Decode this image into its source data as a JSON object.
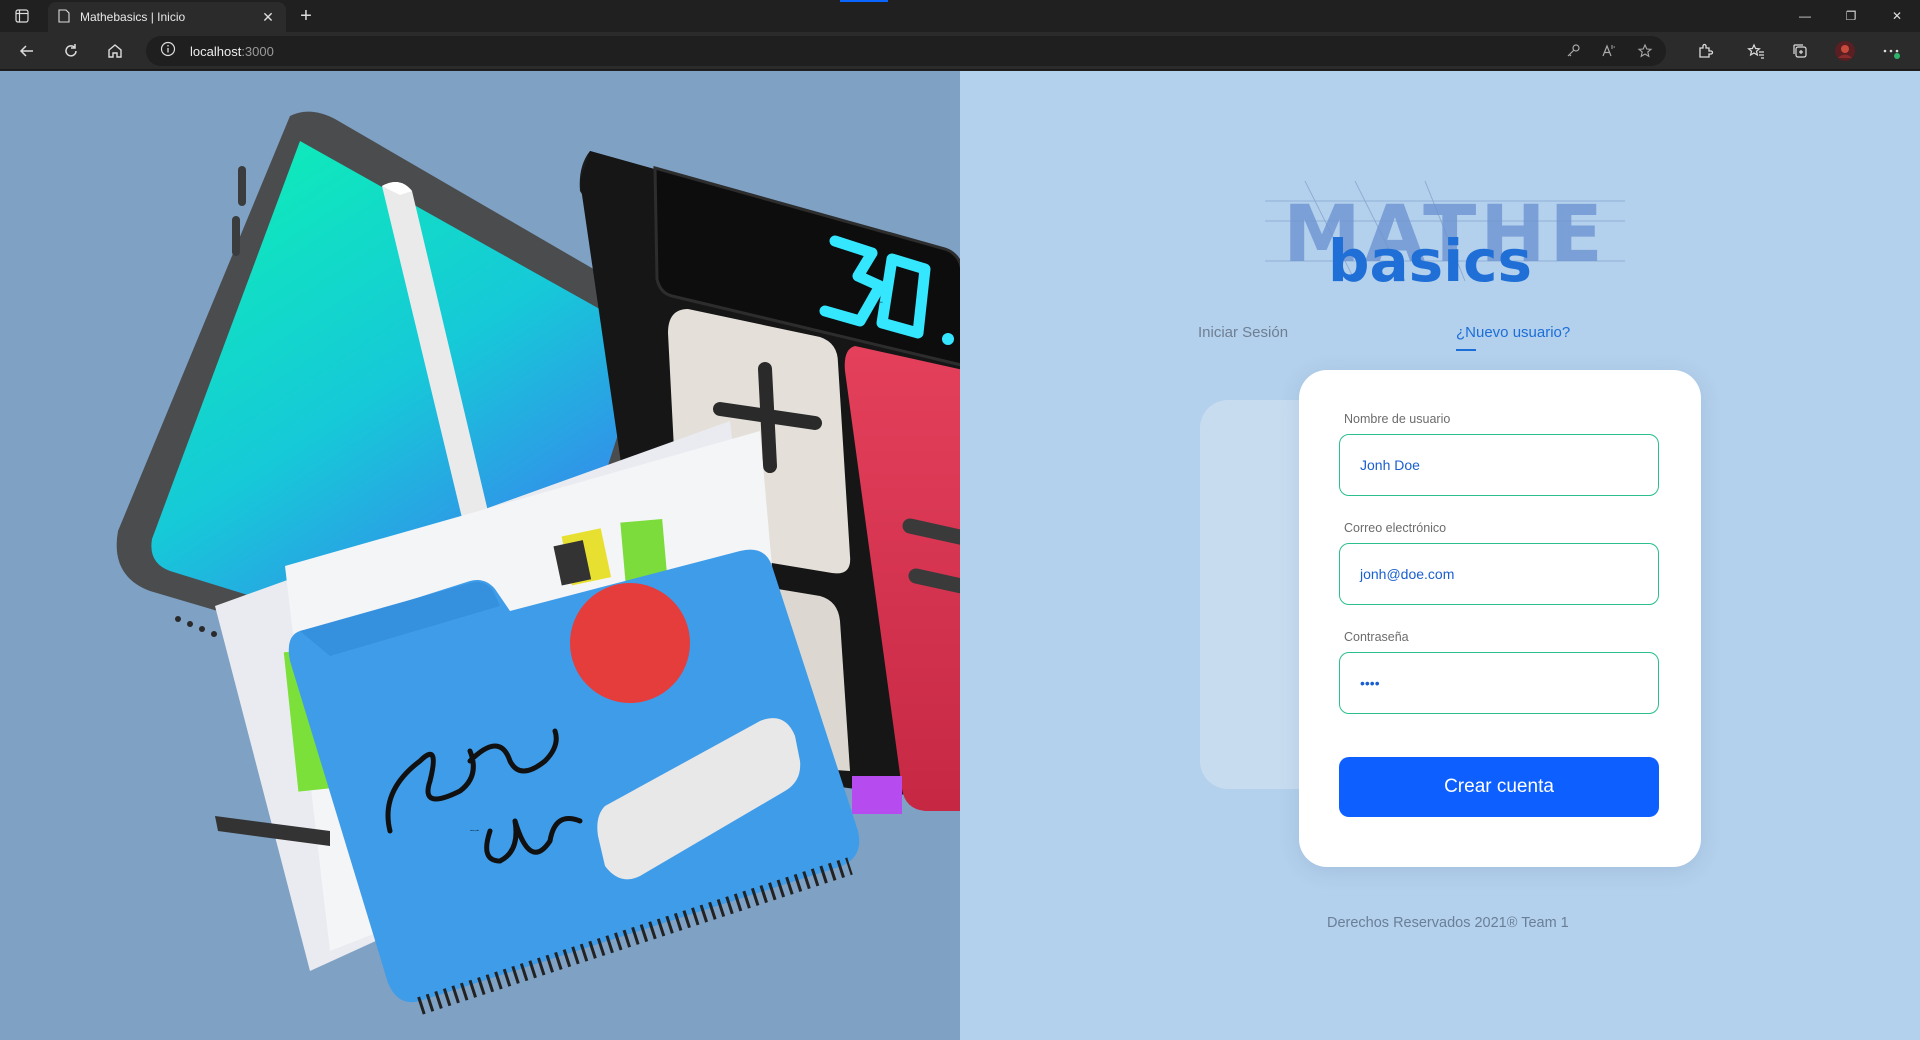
{
  "browser": {
    "tab_title": "Mathebasics | Inicio",
    "url_host": "localhost",
    "url_port": ":3000"
  },
  "logo": {
    "top_text": "MATHE",
    "bottom_text": "basics"
  },
  "auth_tabs": {
    "login": "Iniciar Sesión",
    "register": "¿Nuevo usuario?"
  },
  "form": {
    "username_label": "Nombre de usuario",
    "username_value": "Jonh Doe",
    "email_label": "Correo electrónico",
    "email_value": "jonh@doe.com",
    "password_label": "Contraseña",
    "password_value": "••••",
    "submit_label": "Crear cuenta"
  },
  "illustration": {
    "calculator_display": "30.",
    "signature": "steve jobs"
  },
  "footer": {
    "text": "Derechos Reservados 2021® Team 1"
  },
  "colors": {
    "left_bg": "#7fa1c4",
    "right_bg": "#b3d0ec",
    "accent": "#0d60ff",
    "field_border": "#2bbf8e"
  }
}
